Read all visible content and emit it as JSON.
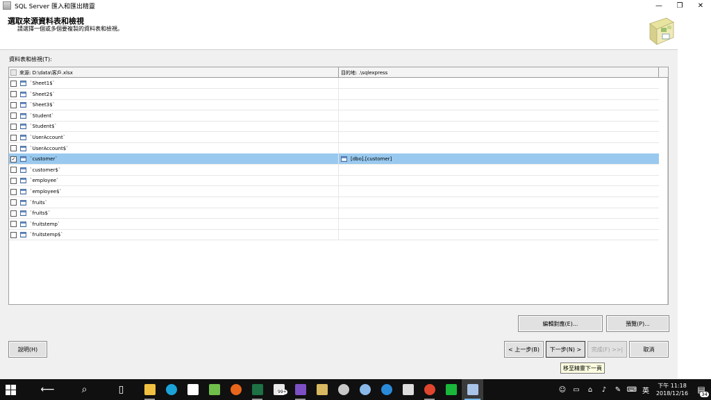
{
  "window": {
    "title": "SQL Server 匯入和匯出精靈",
    "min_glyph": "—",
    "restore_glyph": "❐",
    "close_glyph": "✕"
  },
  "header": {
    "title": "選取來源資料表和檢視",
    "subtitle": "請選擇一個或多個要複製的資料表和檢視。"
  },
  "section_label": "資料表和檢視(T):",
  "grid": {
    "columns": {
      "source": "來源: D:\\data\\客戶.xlsx",
      "destination": "目的地: .\\sqlexpress"
    },
    "rows": [
      {
        "source": "`Sheet1$`",
        "destination": "",
        "checked": false
      },
      {
        "source": "`Sheet2$`",
        "destination": "",
        "checked": false
      },
      {
        "source": "`Sheet3$`",
        "destination": "",
        "checked": false
      },
      {
        "source": "`Student`",
        "destination": "",
        "checked": false
      },
      {
        "source": "`Student$`",
        "destination": "",
        "checked": false
      },
      {
        "source": "`UserAccount`",
        "destination": "",
        "checked": false
      },
      {
        "source": "`UserAccount$`",
        "destination": "",
        "checked": false
      },
      {
        "source": "`customer`",
        "destination": "[dbo].[customer]",
        "checked": true
      },
      {
        "source": "`customer$`",
        "destination": "",
        "checked": false
      },
      {
        "source": "`employee`",
        "destination": "",
        "checked": false
      },
      {
        "source": "`employee$`",
        "destination": "",
        "checked": false
      },
      {
        "source": "`fruits`",
        "destination": "",
        "checked": false
      },
      {
        "source": "`fruits$`",
        "destination": "",
        "checked": false
      },
      {
        "source": "`fruitstemp`",
        "destination": "",
        "checked": false
      },
      {
        "source": "`fruitstemp$`",
        "destination": "",
        "checked": false
      }
    ]
  },
  "buttons": {
    "edit_mappings": "編輯對應(E)...",
    "preview": "預覽(P)...",
    "help": "說明(H)",
    "back": "< 上一步(B)",
    "next": "下一步(N) >",
    "finish": "完成(F) >>|",
    "cancel": "取消"
  },
  "tooltip": "移至精靈下一頁",
  "taskbar": {
    "badge": "99+",
    "tray_lang": "英",
    "time": "下午 11:18",
    "date": "2018/12/16",
    "notification_count": "34"
  },
  "colors": {
    "selection": "#99c9ef",
    "taskbar": "#101010",
    "window": "#f0f0f0"
  }
}
